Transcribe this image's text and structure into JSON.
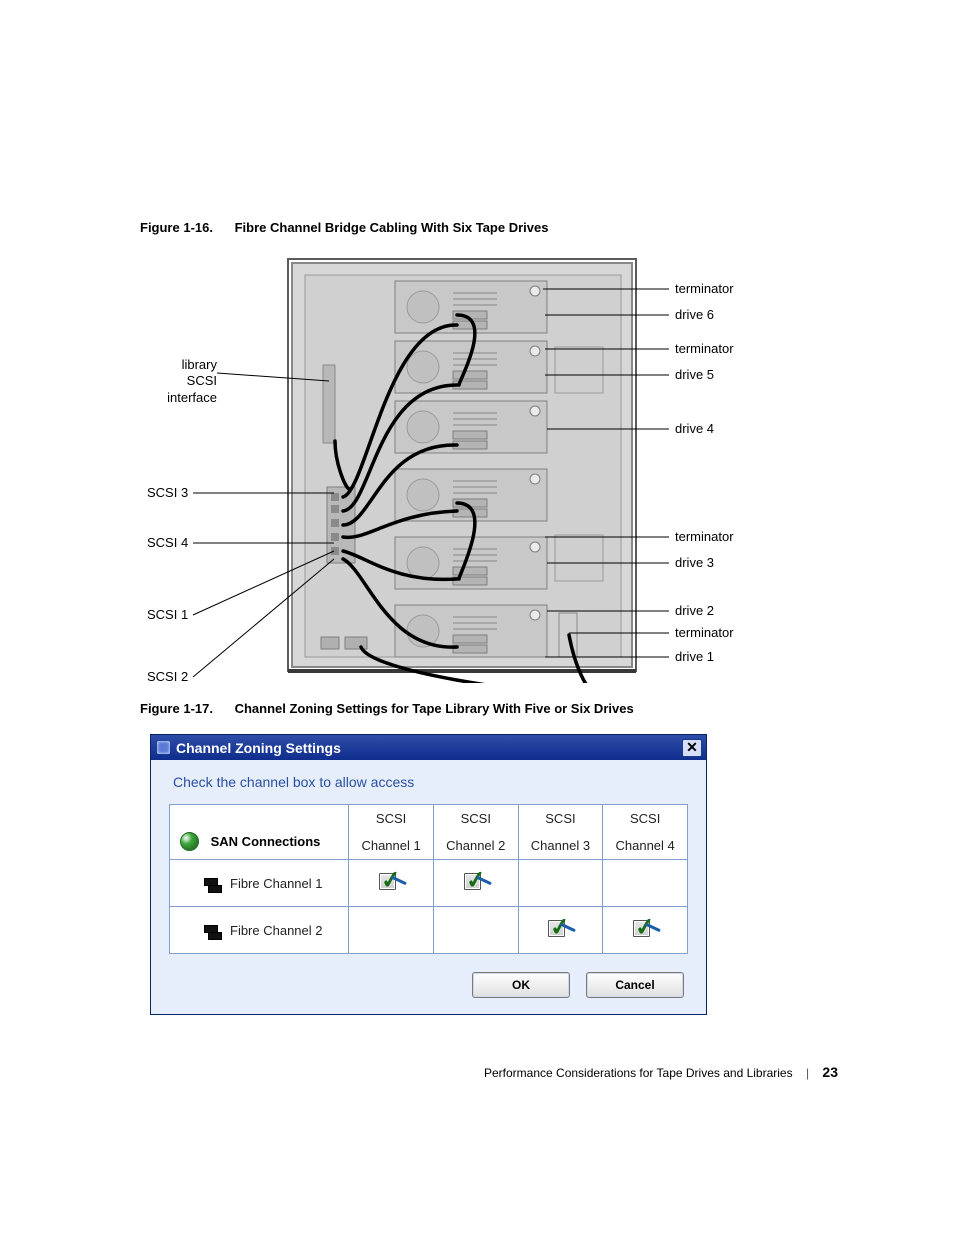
{
  "figure16": {
    "number": "Figure 1-16.",
    "title": "Fibre Channel Bridge Cabling With Six Tape Drives",
    "labels_left": {
      "lib_scsi": "library SCSI\ninterface",
      "scsi3": "SCSI 3",
      "scsi4": "SCSI 4",
      "scsi1": "SCSI 1",
      "scsi2": "SCSI 2"
    },
    "labels_right": {
      "term_a": "terminator",
      "drive6": "drive 6",
      "term_b": "terminator",
      "drive5": "drive 5",
      "drive4": "drive 4",
      "term_c": "terminator",
      "drive3": "drive 3",
      "drive2": "drive 2",
      "term_d": "terminator",
      "drive1": "drive 1"
    }
  },
  "figure17": {
    "number": "Figure 1-17.",
    "title": "Channel Zoning Settings for Tape Library With Five or Six Drives"
  },
  "zoning_dialog": {
    "window_title": "Channel Zoning Settings",
    "prompt": "Check the channel box to allow access",
    "corner_label": "SAN Connections",
    "col_top": "SCSI",
    "columns": [
      "Channel 1",
      "Channel 2",
      "Channel 3",
      "Channel 4"
    ],
    "rows": [
      {
        "label": "Fibre Channel 1",
        "cells": [
          true,
          true,
          false,
          false
        ]
      },
      {
        "label": "Fibre Channel 2",
        "cells": [
          false,
          false,
          true,
          true
        ]
      }
    ],
    "buttons": {
      "ok": "OK",
      "cancel": "Cancel"
    }
  },
  "footer": {
    "section": "Performance Considerations for Tape Drives and Libraries",
    "page": "23"
  },
  "chart_data": {
    "type": "table",
    "title": "Channel Zoning Settings",
    "columns": [
      "SAN Connection",
      "SCSI Channel 1",
      "SCSI Channel 2",
      "SCSI Channel 3",
      "SCSI Channel 4"
    ],
    "rows": [
      [
        "Fibre Channel 1",
        true,
        true,
        false,
        false
      ],
      [
        "Fibre Channel 2",
        false,
        false,
        true,
        true
      ]
    ]
  }
}
